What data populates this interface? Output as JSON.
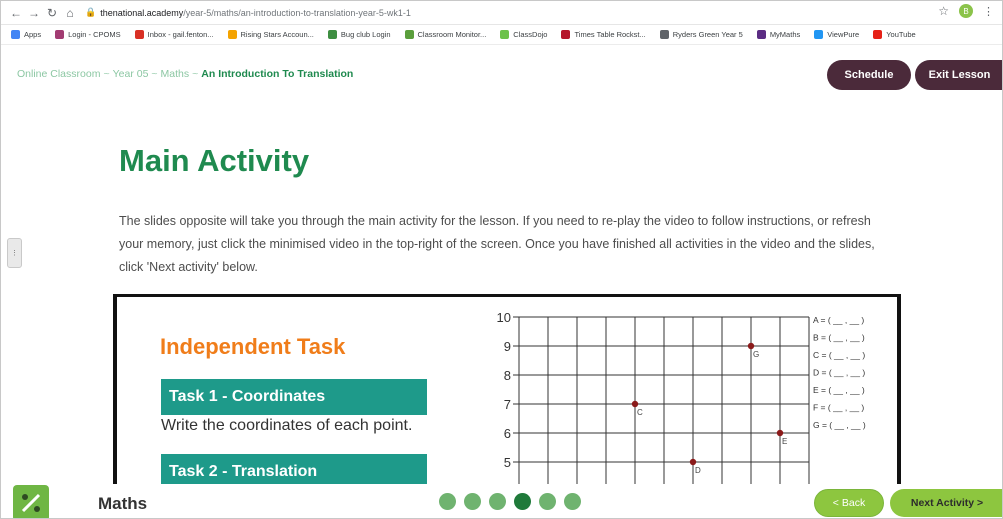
{
  "browser": {
    "url_domain": "thenational.academy",
    "url_path": "/year-5/maths/an-introduction-to-translation-year-5-wk1-1",
    "profile_initial": "B",
    "bookmarks": [
      {
        "label": "Apps",
        "icon": "apps-grid-icon",
        "color": "#4285f4"
      },
      {
        "label": "Login - CPOMS",
        "icon": "cpoms-icon",
        "color": "#a23b72"
      },
      {
        "label": "Inbox - gail.fenton...",
        "icon": "gmail-icon",
        "color": "#d93025"
      },
      {
        "label": "Rising Stars Accoun...",
        "icon": "rising-stars-icon",
        "color": "#f4a300"
      },
      {
        "label": "Bug club Login",
        "icon": "bug-club-icon",
        "color": "#3e8e41"
      },
      {
        "label": "Classroom Monitor...",
        "icon": "classroom-monitor-icon",
        "color": "#5a9e3c"
      },
      {
        "label": "ClassDojo",
        "icon": "classdojo-icon",
        "color": "#6cc24a"
      },
      {
        "label": "Times Table Rockst...",
        "icon": "ttrockstars-icon",
        "color": "#b5162b"
      },
      {
        "label": "Ryders Green Year 5",
        "icon": "globe-icon",
        "color": "#5f6368"
      },
      {
        "label": "MyMaths",
        "icon": "mymaths-icon",
        "color": "#5b2c83"
      },
      {
        "label": "ViewPure",
        "icon": "viewpure-icon",
        "color": "#2196f3"
      },
      {
        "label": "YouTube",
        "icon": "youtube-icon",
        "color": "#e62117"
      }
    ]
  },
  "breadcrumb": {
    "items": [
      "Online Classroom",
      "Year 05",
      "Maths"
    ],
    "separator": "~",
    "current": "An Introduction To Translation"
  },
  "header": {
    "schedule_label": "Schedule",
    "exit_label": "Exit Lesson"
  },
  "main": {
    "title": "Main Activity",
    "intro": "The slides opposite will take you through the main activity for the lesson. If you need to re-play the video to follow instructions, or refresh your memory, just click the minimised video in the top-right of the screen. Once you have finished all activities in the video and the slides, click 'Next activity' below."
  },
  "slide": {
    "heading": "Independent Task",
    "task1_title": "Task 1 - Coordinates",
    "task1_desc": "Write the coordinates of each point.",
    "task2_title": "Task 2 - Translation",
    "grid": {
      "y_ticks": [
        10,
        9,
        8,
        7,
        6,
        5
      ],
      "points": [
        {
          "label": "G",
          "x": 8,
          "y": 9
        },
        {
          "label": "C",
          "x": 4,
          "y": 7
        },
        {
          "label": "E",
          "x": 9,
          "y": 6
        },
        {
          "label": "D",
          "x": 6,
          "y": 5
        }
      ],
      "answers": [
        "A = ( __ , __ )",
        "B = ( __ , __ )",
        "C = ( __ , __ )",
        "D = ( __ , __ )",
        "E = ( __ , __ )",
        "F = ( __ , __ )",
        "G = ( __ , __ )"
      ],
      "point_color": "#8b1a1a"
    }
  },
  "footer": {
    "subject": "Maths",
    "progress": {
      "total": 6,
      "current": 4
    },
    "back_label": "< Back",
    "next_label": "Next Activity >"
  }
}
